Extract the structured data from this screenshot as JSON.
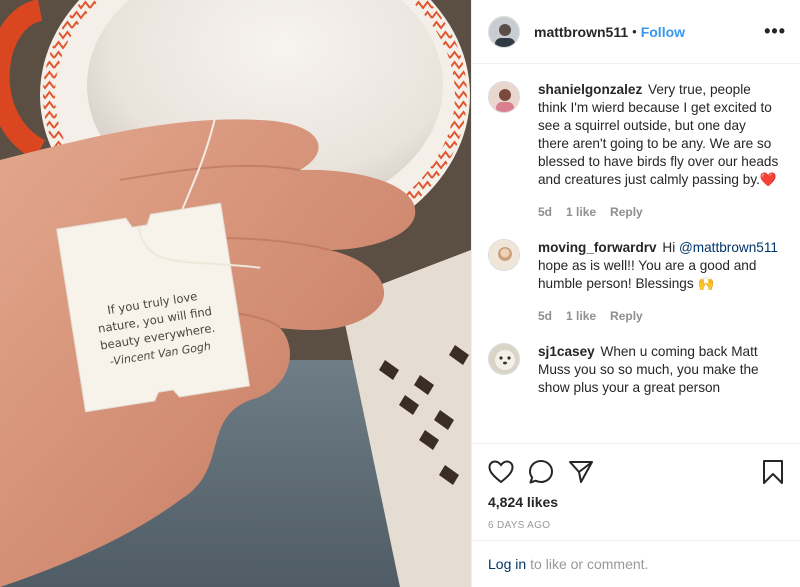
{
  "post": {
    "photo_quote": {
      "lines": [
        "If you truly love",
        "nature, you will find",
        "beauty everywhere."
      ],
      "author": "-Vincent Van Gogh"
    }
  },
  "header": {
    "username": "mattbrown511",
    "separator": "•",
    "follow_label": "Follow",
    "more_label": "•••"
  },
  "comments": [
    {
      "username": "shanielgonzalez",
      "text": "Very true, people think I'm wierd because I get excited to see a squirrel outside, but one day there aren't going to be any. We are so blessed to have birds fly over our heads and creatures just calmly passing by.",
      "emoji": "❤️",
      "age": "5d",
      "likes": "1 like",
      "reply_label": "Reply"
    },
    {
      "username": "moving_forwardrv",
      "text_before": "Hi",
      "mention": "@mattbrown511",
      "text_after": "hope as is well!! You are a good and humble person! Blessings",
      "emoji": "🙌",
      "age": "5d",
      "likes": "1 like",
      "reply_label": "Reply"
    },
    {
      "username": "sj1casey",
      "text": "When u coming back Matt Muss you so so much, you make the show plus your a great person"
    }
  ],
  "actions": {
    "like_icon": "heart-icon",
    "comment_icon": "comment-icon",
    "share_icon": "share-icon",
    "save_icon": "bookmark-icon",
    "likes": "4,824 likes",
    "date": "6 DAYS AGO"
  },
  "login": {
    "link_label": "Log in",
    "rest": "to like or comment."
  },
  "colors": {
    "accent": "#3897f0",
    "link": "#003569",
    "muted": "#8e8e8e",
    "border": "#efefef"
  }
}
